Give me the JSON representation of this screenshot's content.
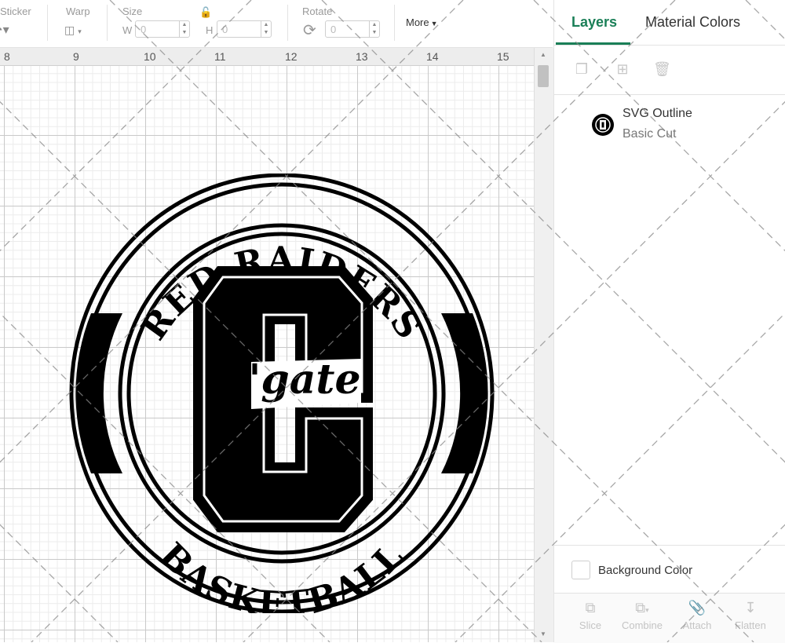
{
  "toolbar": {
    "sticker_label": "Sticker",
    "warp_label": "Warp",
    "size_label": "Size",
    "width_letter": "W",
    "width_value": "0",
    "height_letter": "H",
    "height_value": "0",
    "rotate_label": "Rotate",
    "rotate_value": "0",
    "more_label": "More"
  },
  "ruler": {
    "ticks": [
      "8",
      "9",
      "10",
      "11",
      "12",
      "13",
      "14",
      "15"
    ]
  },
  "design": {
    "top_text": "RED RAIDERS",
    "bottom_text": "BASKETBALL",
    "monogram": "C",
    "script_text": "'gate",
    "ink_color": "#000000"
  },
  "panel": {
    "tabs": [
      "Layers",
      "Material Colors"
    ],
    "active_tab": "Layers",
    "accent_color": "#1a7f57",
    "layers": [
      {
        "name": "SVG Outline",
        "operation": "Basic Cut"
      }
    ],
    "background_color_label": "Background Color",
    "bottom_tools": [
      "Slice",
      "Combine",
      "Attach",
      "Flatten"
    ]
  }
}
